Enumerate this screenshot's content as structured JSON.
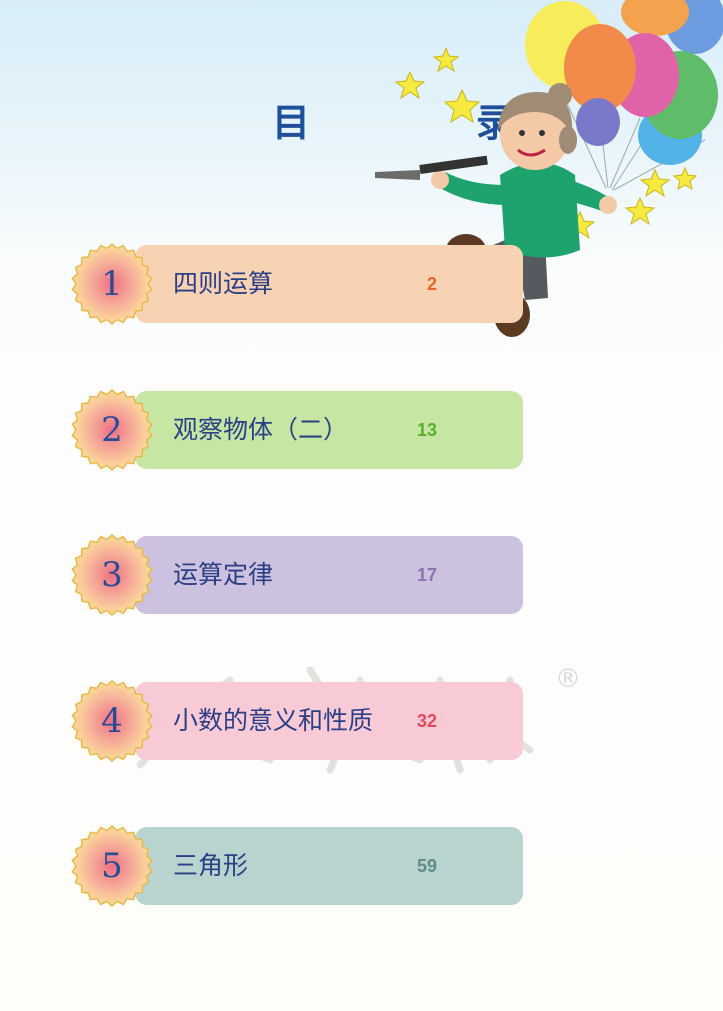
{
  "title": "目　录",
  "chapters": [
    {
      "number": "1",
      "title": "四则运算",
      "page": "2",
      "pill_color": "#f8d3b3",
      "page_color": "#e8682a"
    },
    {
      "number": "2",
      "title": "观察物体（二）",
      "page": "13",
      "pill_color": "#c7e6a3",
      "page_color": "#58b02c"
    },
    {
      "number": "3",
      "title": "运算定律",
      "page": "17",
      "pill_color": "#ccc1de",
      "page_color": "#8a74b3"
    },
    {
      "number": "4",
      "title": "小数的意义和性质",
      "page": "32",
      "pill_color": "#f7cad6",
      "page_color": "#e04b5a"
    },
    {
      "number": "5",
      "title": "三角形",
      "page": "59",
      "pill_color": "#b9d3cf",
      "page_color": "#5e8d88"
    }
  ],
  "watermark_symbol": "®"
}
